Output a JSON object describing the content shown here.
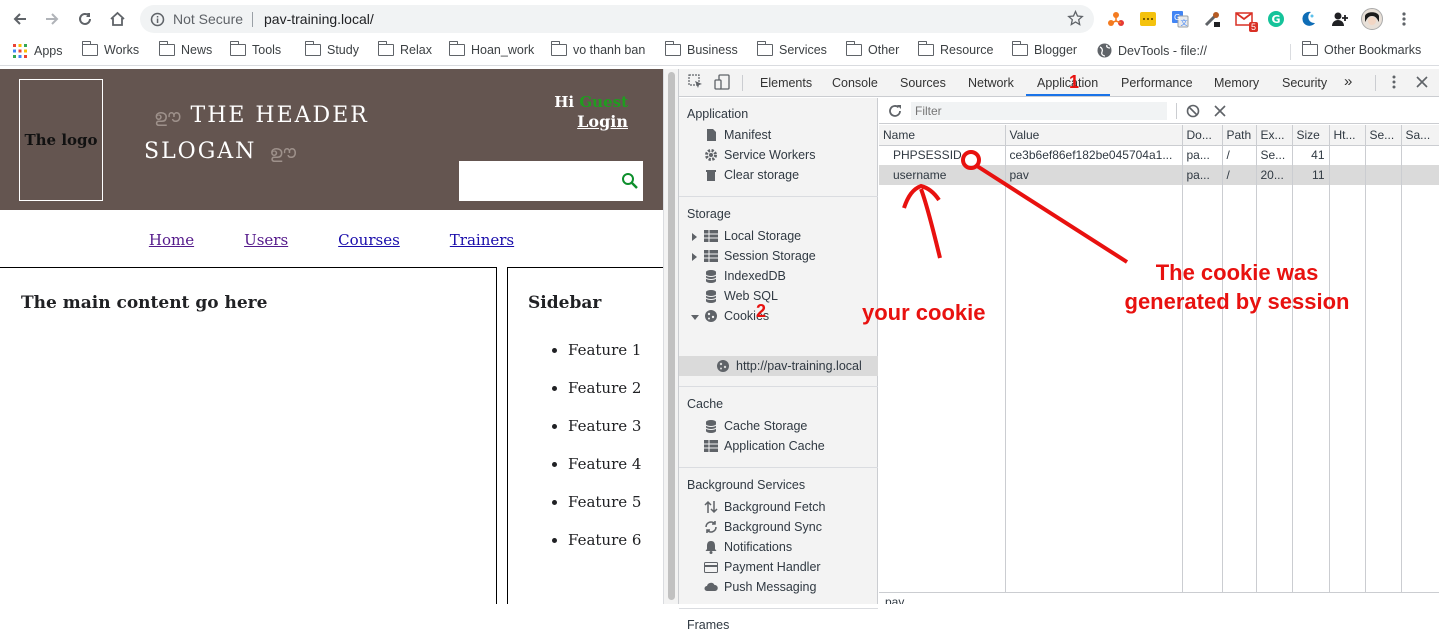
{
  "browser": {
    "security_label": "Not Secure",
    "url": "pav-training.local/",
    "gmail_badge": "5",
    "bookmarks": [
      "Apps",
      "Works",
      "News",
      "Tools",
      "Study",
      "Relax",
      "Hoan_work",
      "vo thanh ban",
      "Business",
      "Services",
      "Other",
      "Resource",
      "Blogger",
      "DevTools - file://",
      "Other Bookmarks"
    ]
  },
  "page": {
    "logo": "The logo",
    "title": "THE HEADER",
    "slogan": "SLOGAN",
    "greeting_prefix": "Hi",
    "greeting_user": "Guest",
    "login": "Login",
    "nav": [
      "Home",
      "Users",
      "Courses",
      "Trainers"
    ],
    "main_heading": "The main content go here",
    "sidebar_heading": "Sidebar",
    "features": [
      "Feature 1",
      "Feature 2",
      "Feature 3",
      "Feature 4",
      "Feature 5",
      "Feature 6"
    ]
  },
  "devtools": {
    "tabs": [
      "Elements",
      "Console",
      "Sources",
      "Network",
      "Application",
      "Performance",
      "Memory",
      "Security"
    ],
    "more_tabs": "»",
    "active_tab": "Application",
    "sections": {
      "application": {
        "title": "Application",
        "items": [
          "Manifest",
          "Service Workers",
          "Clear storage"
        ]
      },
      "storage": {
        "title": "Storage",
        "items": [
          "Local Storage",
          "Session Storage",
          "IndexedDB",
          "Web SQL",
          "Cookies"
        ],
        "cookie_origin": "http://pav-training.local"
      },
      "cache": {
        "title": "Cache",
        "items": [
          "Cache Storage",
          "Application Cache"
        ]
      },
      "background": {
        "title": "Background Services",
        "items": [
          "Background Fetch",
          "Background Sync",
          "Notifications",
          "Payment Handler",
          "Push Messaging"
        ]
      },
      "frames": {
        "title": "Frames"
      }
    },
    "filter_placeholder": "Filter",
    "columns": [
      "Name",
      "Value",
      "Do...",
      "Path",
      "Ex...",
      "Size",
      "Ht...",
      "Se...",
      "Sa..."
    ],
    "cookies": [
      {
        "name": "PHPSESSID",
        "value": "ce3b6ef86ef182be045704a1...",
        "domain": "pa...",
        "path": "/",
        "expires": "Se...",
        "size": "41"
      },
      {
        "name": "username",
        "value": "pav",
        "domain": "pa...",
        "path": "/",
        "expires": "20...",
        "size": "11"
      }
    ],
    "preview_value": "pav"
  },
  "annotations": {
    "marker_1": "1",
    "marker_2": "2",
    "your_cookie": "your cookie",
    "session_line1": "The cookie was",
    "session_line2": "generated by session",
    "color": "#e8110f"
  }
}
